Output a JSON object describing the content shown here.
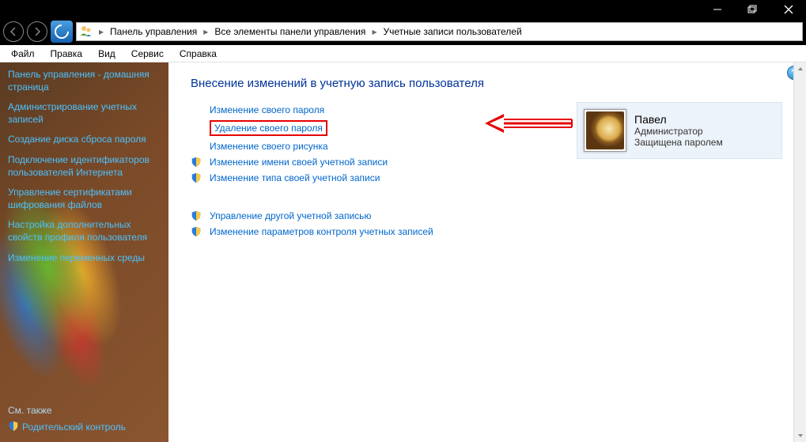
{
  "titlebar": {},
  "breadcrumb": {
    "seg1": "Панель управления",
    "seg2": "Все элементы панели управления",
    "seg3": "Учетные записи пользователей"
  },
  "menu": {
    "file": "Файл",
    "edit": "Правка",
    "view": "Вид",
    "service": "Сервис",
    "help": "Справка"
  },
  "sidebar": {
    "items": [
      "Панель управления - домашняя страница",
      "Администрирование учетных записей",
      "Создание диска сброса пароля",
      "Подключение идентификаторов пользователей Интернета",
      "Управление сертификатами шифрования файлов",
      "Настройка дополнительных свойств профиля пользователя",
      "Изменение переменных среды"
    ],
    "see_also": "См. также",
    "parental": "Родительский контроль"
  },
  "main": {
    "heading": "Внесение изменений в учетную запись пользователя",
    "actions": {
      "change_pw": "Изменение своего пароля",
      "remove_pw": "Удаление своего пароля",
      "change_pic": "Изменение своего рисунка",
      "change_name": "Изменение имени своей учетной записи",
      "change_type": "Изменение типа своей учетной записи",
      "manage_other": "Управление другой учетной записью",
      "uac": "Изменение параметров контроля учетных записей"
    }
  },
  "account": {
    "name": "Павел",
    "role": "Администратор",
    "protected": "Защищена паролем"
  },
  "help": "?"
}
